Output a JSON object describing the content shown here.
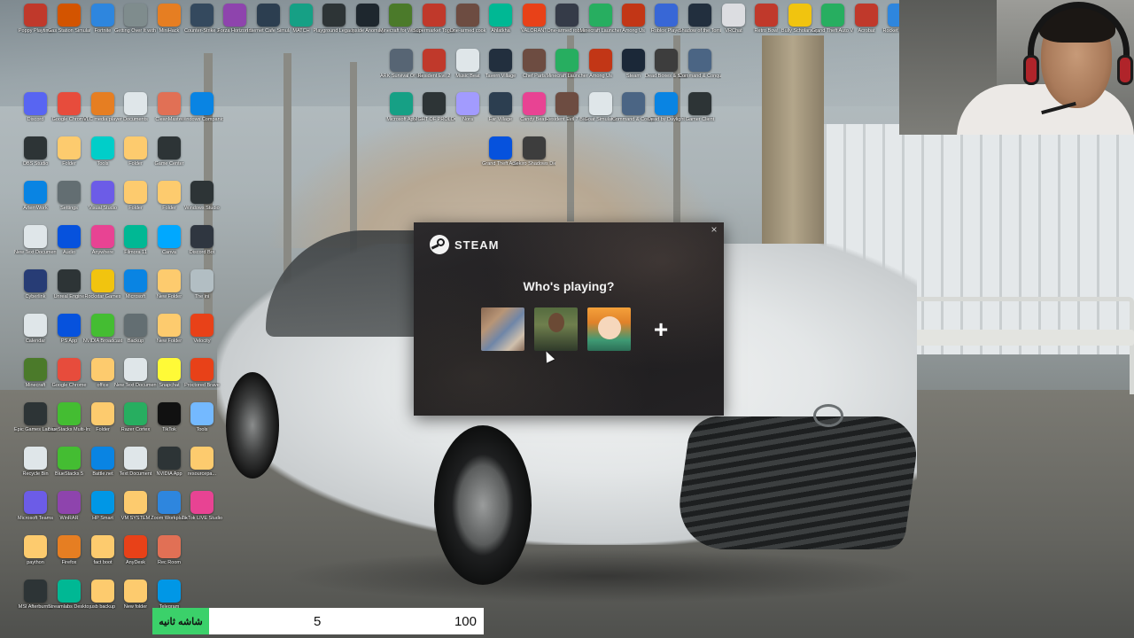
{
  "desktop_icons": [
    {
      "label": "Poppy Playtime",
      "icon": "poppy-icon",
      "color": "#c0392b"
    },
    {
      "label": "Gas Station Simulator",
      "icon": "gas-station-icon",
      "color": "#d35400"
    },
    {
      "label": "Fortnite",
      "icon": "fortnite-icon",
      "color": "#2e86de"
    },
    {
      "label": "Getting Over It with Bennett",
      "icon": "getting-over-it-icon",
      "color": "#7f8c8d"
    },
    {
      "label": "MiniHack",
      "icon": "mi-icon",
      "color": "#e67e22"
    },
    {
      "label": "Counter-Strike 2",
      "icon": "cs2-icon",
      "color": "#34495e"
    },
    {
      "label": "Forza Horizon 5",
      "icon": "forza-icon",
      "color": "#8e44ad"
    },
    {
      "label": "Internet Cafe Simulator 2",
      "icon": "cafe-icon",
      "color": "#2c3e50"
    },
    {
      "label": "MATCH",
      "icon": "match-icon",
      "color": "#16a085"
    },
    {
      "label": "Playground Legacy",
      "icon": "playground-icon",
      "color": "#2d3436"
    },
    {
      "label": "Inside Anomaly",
      "icon": "anomaly-icon",
      "color": "#1e272e"
    },
    {
      "label": "Minecraft for Windows",
      "icon": "minecraft-icon",
      "color": "#4b7a2a"
    },
    {
      "label": "Supermarket Together",
      "icon": "supermarket-icon",
      "color": "#c0392b"
    },
    {
      "label": "One-armed cook",
      "icon": "cook-icon",
      "color": "#6d4c41"
    },
    {
      "label": "Ahlatkha",
      "icon": "ahlatkha-icon",
      "color": "#00b894"
    },
    {
      "label": "VALORANT",
      "icon": "valorant-icon",
      "color": "#e84118"
    },
    {
      "label": "One-armed robber",
      "icon": "robber-icon",
      "color": "#353b48"
    },
    {
      "label": "Minecraft Launcher",
      "icon": "minecraft-launcher-icon",
      "color": "#27ae60"
    },
    {
      "label": "Among Us",
      "icon": "among-us-icon",
      "color": "#c23616"
    },
    {
      "label": "Roblox Player",
      "icon": "roblox-icon",
      "color": "#3867d6"
    },
    {
      "label": "Shadow of the Tomb",
      "icon": "tomb-icon",
      "color": "#222f3e"
    },
    {
      "label": "VRChat",
      "icon": "vrchat-icon",
      "color": "#dcdde1"
    },
    {
      "label": "Retro Bowl",
      "icon": "retro-bowl-icon",
      "color": "#c0392b"
    },
    {
      "label": "Bully Scholarship",
      "icon": "bully-icon",
      "color": "#f1c40f"
    },
    {
      "label": "Grand Theft Auto V Legacy",
      "icon": "gta-icon",
      "color": "#27ae60"
    },
    {
      "label": "Acrobat",
      "icon": "acrobat-icon",
      "color": "#c0392b"
    },
    {
      "label": "Rocket League",
      "icon": "rocket-league-icon",
      "color": "#2e86de"
    },
    {
      "label": "Discord",
      "icon": "discord-icon",
      "color": "#5865f2"
    },
    {
      "label": "Google Chrome",
      "icon": "chrome-icon",
      "color": "#e74c3c"
    },
    {
      "label": "VLC media player",
      "icon": "vlc-icon",
      "color": "#e67e22"
    },
    {
      "label": "Documents",
      "icon": "document-icon",
      "color": "#dfe6e9"
    },
    {
      "label": "CleanMaster",
      "icon": "clean-icon",
      "color": "#e17055"
    },
    {
      "label": "Windows Companion",
      "icon": "companion-icon",
      "color": "#0984e3"
    },
    {
      "label": "OBS Studio",
      "icon": "obs-icon",
      "color": "#2d3436"
    },
    {
      "label": "Folder",
      "icon": "folder-icon",
      "color": "#fdcb6e"
    },
    {
      "label": "Tools",
      "icon": "tools-icon",
      "color": "#00cec9"
    },
    {
      "label": "Folder",
      "icon": "folder-icon",
      "color": "#fdcb6e"
    },
    {
      "label": "Game Center",
      "icon": "game-center-icon",
      "color": "#2d3436"
    },
    {
      "label": "ArtemWork",
      "icon": "artemwork-icon",
      "color": "#0984e3"
    },
    {
      "label": "Settings",
      "icon": "settings-icon",
      "color": "#636e72"
    },
    {
      "label": "Visual Studio",
      "icon": "vs-icon",
      "color": "#6c5ce7"
    },
    {
      "label": "Folder",
      "icon": "folder-icon",
      "color": "#fdcb6e"
    },
    {
      "label": "Folder",
      "icon": "folder-icon",
      "color": "#fdcb6e"
    },
    {
      "label": "Windows Studio",
      "icon": "windows-icon",
      "color": "#2d3436"
    },
    {
      "label": "New Text Document",
      "icon": "text-doc-icon",
      "color": "#dfe6e9"
    },
    {
      "label": "Audio",
      "icon": "audio-icon",
      "color": "#0652dd"
    },
    {
      "label": "Anywhere",
      "icon": "anywhere-icon",
      "color": "#e84393"
    },
    {
      "label": "Filmora 11",
      "icon": "filmora-icon",
      "color": "#00b894"
    },
    {
      "label": "Canva",
      "icon": "canva-icon",
      "color": "#00a8ff"
    },
    {
      "label": "Discord Bot",
      "icon": "discord-bot-icon",
      "color": "#2f3640"
    },
    {
      "label": "Cyberlink",
      "icon": "cyberlink-icon",
      "color": "#273c75"
    },
    {
      "label": "Unreal Engine",
      "icon": "unreal-icon",
      "color": "#2d3436"
    },
    {
      "label": "Rockstar Games",
      "icon": "rockstar-icon",
      "color": "#f1c40f"
    },
    {
      "label": "Microsoft",
      "icon": "microsoft-icon",
      "color": "#0984e3"
    },
    {
      "label": "New Folder",
      "icon": "folder-icon",
      "color": "#fdcb6e"
    },
    {
      "label": "The ini",
      "icon": "ini-icon",
      "color": "#b2bec3"
    },
    {
      "label": "Calendar",
      "icon": "calendar-icon",
      "color": "#dfe6e9"
    },
    {
      "label": "PS App",
      "icon": "ps-icon",
      "color": "#0652dd"
    },
    {
      "label": "NVIDIA Broadcast",
      "icon": "nvidia-icon",
      "color": "#44bd32"
    },
    {
      "label": "Backup",
      "icon": "backup-icon",
      "color": "#636e72"
    },
    {
      "label": "New Folder",
      "icon": "folder-icon",
      "color": "#fdcb6e"
    },
    {
      "label": "Velocity",
      "icon": "velocity-icon",
      "color": "#e84118"
    },
    {
      "label": "Minecraft",
      "icon": "minecraft-icon",
      "color": "#4b7a2a"
    },
    {
      "label": "Google Chrome",
      "icon": "chrome-icon",
      "color": "#e74c3c"
    },
    {
      "label": "office",
      "icon": "office-icon",
      "color": "#fdcb6e"
    },
    {
      "label": "New Text Document",
      "icon": "text-doc-icon",
      "color": "#dfe6e9"
    },
    {
      "label": "Snapchat",
      "icon": "snapchat-icon",
      "color": "#fffa37"
    },
    {
      "label": "Proctored Brave",
      "icon": "brave-icon",
      "color": "#e84118"
    },
    {
      "label": "Epic Games Launcher",
      "icon": "epic-icon",
      "color": "#2d3436"
    },
    {
      "label": "BlueStacks Multi-Instance",
      "icon": "bluestacks-icon",
      "color": "#44bd32"
    },
    {
      "label": "Folder",
      "icon": "folder-icon",
      "color": "#fdcb6e"
    },
    {
      "label": "Razer Cortex",
      "icon": "razer-icon",
      "color": "#27ae60"
    },
    {
      "label": "TikTok",
      "icon": "tiktok-icon",
      "color": "#111111"
    },
    {
      "label": "Tools",
      "icon": "tools-icon",
      "color": "#74b9ff"
    },
    {
      "label": "Recycle Bin",
      "icon": "recycle-bin-icon",
      "color": "#dfe6e9"
    },
    {
      "label": "BlueStacks 5",
      "icon": "bluestacks-icon",
      "color": "#44bd32"
    },
    {
      "label": "Battle.net",
      "icon": "battlenet-icon",
      "color": "#0984e3"
    },
    {
      "label": "Text Document",
      "icon": "text-doc-icon",
      "color": "#dfe6e9"
    },
    {
      "label": "NVIDIA App",
      "icon": "nvidia-icon",
      "color": "#2d3436"
    },
    {
      "label": "resourcepa...",
      "icon": "folder-icon",
      "color": "#fdcb6e"
    },
    {
      "label": "Microsoft Teams",
      "icon": "teams-icon",
      "color": "#6c5ce7"
    },
    {
      "label": "WinRAR",
      "icon": "winrar-icon",
      "color": "#8e44ad"
    },
    {
      "label": "HP Smart",
      "icon": "hp-icon",
      "color": "#0097e6"
    },
    {
      "label": "VM SYSTEM",
      "icon": "folder-icon",
      "color": "#fdcb6e"
    },
    {
      "label": "Zoom Workplace",
      "icon": "zoom-icon",
      "color": "#2e86de"
    },
    {
      "label": "TikTok LIVE Studio",
      "icon": "tiktok-live-icon",
      "color": "#e84393"
    },
    {
      "label": "paython",
      "icon": "folder-icon",
      "color": "#fdcb6e"
    },
    {
      "label": "Firefox",
      "icon": "firefox-icon",
      "color": "#e67e22"
    },
    {
      "label": "fact boot",
      "icon": "folder-icon",
      "color": "#fdcb6e"
    },
    {
      "label": "AnyDesk",
      "icon": "anydesk-icon",
      "color": "#e84118"
    },
    {
      "label": "Rec Room",
      "icon": "recroom-icon",
      "color": "#e17055"
    },
    {
      "label": "MSI Afterburner",
      "icon": "msi-icon",
      "color": "#2d3436"
    },
    {
      "label": "Streamlabs Desktop",
      "icon": "streamlabs-icon",
      "color": "#00b894"
    },
    {
      "label": "usb backup",
      "icon": "folder-icon",
      "color": "#fdcb6e"
    },
    {
      "label": "New folder",
      "icon": "folder-icon",
      "color": "#fdcb6e"
    },
    {
      "label": "Telegram",
      "icon": "telegram-icon",
      "color": "#0097e6"
    },
    {
      "label": "ARK Survival Of the Fittest",
      "icon": "ark-icon",
      "color": "#576574"
    },
    {
      "label": "Resident Evil 2",
      "icon": "re2-icon",
      "color": "#c0392b"
    },
    {
      "label": "Music Beat",
      "icon": "music-icon",
      "color": "#dfe6e9"
    },
    {
      "label": "Tavern Village",
      "icon": "tavern-icon",
      "color": "#222f3e"
    },
    {
      "label": "Chef Parts",
      "icon": "chef-icon",
      "color": "#6d4c41"
    },
    {
      "label": "Minecraft Launcher",
      "icon": "minecraft-launcher-icon",
      "color": "#27ae60"
    },
    {
      "label": "Among Us",
      "icon": "among-us-icon",
      "color": "#c23616"
    },
    {
      "label": "Steam",
      "icon": "steam-icon",
      "color": "#1b2838"
    },
    {
      "label": "Dead Boxes & Shadows",
      "icon": "deadboxes-icon",
      "color": "#3d3d3d"
    },
    {
      "label": "Command & Conquer",
      "icon": "cnc-icon",
      "color": "#4b6584"
    },
    {
      "label": "Microsoft App",
      "icon": "ms-app-icon",
      "color": "#16a085"
    },
    {
      "label": "NIGHT OF PROLOGUE",
      "icon": "night-icon",
      "color": "#2d3436"
    },
    {
      "label": "Nora",
      "icon": "nora-icon",
      "color": "#a29bfe"
    },
    {
      "label": "Far Village",
      "icon": "village-icon",
      "color": "#2c3e50"
    },
    {
      "label": "Candy Beats",
      "icon": "candy-icon",
      "color": "#e84393"
    },
    {
      "label": "Resident Evil 7 Biohazard",
      "icon": "re7-icon",
      "color": "#6d4c41"
    },
    {
      "label": "Goat Simulator",
      "icon": "goat-icon",
      "color": "#dfe6e9"
    },
    {
      "label": "Command & Conquer Gen",
      "icon": "cnc-gen-icon",
      "color": "#4b6584"
    },
    {
      "label": "Dead by Daylight",
      "icon": "dbd-icon",
      "color": "#0984e3"
    },
    {
      "label": "Gamer Client",
      "icon": "client-icon",
      "color": "#2d3436"
    },
    {
      "label": "Grand Theft Auto",
      "icon": "gta-sa-icon",
      "color": "#0652dd"
    },
    {
      "label": "Sekiro Shadows Die Twice",
      "icon": "sekiro-icon",
      "color": "#3d3d3d"
    }
  ],
  "steam_dialog": {
    "brand": "STEAM",
    "title": "Who's playing?",
    "close": "×",
    "add": "+",
    "profiles": [
      {
        "icon": "profile-avatar-1"
      },
      {
        "icon": "profile-avatar-2"
      },
      {
        "icon": "profile-avatar-3"
      }
    ]
  },
  "stat_bar": {
    "label": "شاشه ثانيه",
    "value_a": "5",
    "value_b": "100"
  }
}
